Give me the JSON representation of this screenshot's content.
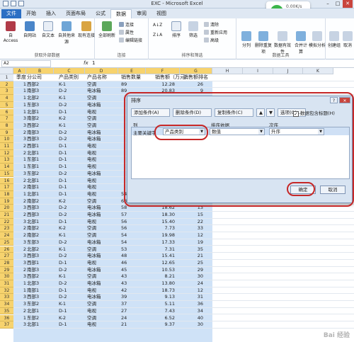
{
  "window": {
    "title": "EXC - Microsoft Excel"
  },
  "network": {
    "speed": "0.00K/s",
    "count": "1"
  },
  "tabs": [
    {
      "label": "文件"
    },
    {
      "label": "开始"
    },
    {
      "label": "插入"
    },
    {
      "label": "页面布局"
    },
    {
      "label": "公式"
    },
    {
      "label": "数据"
    },
    {
      "label": "审阅"
    },
    {
      "label": "视图"
    }
  ],
  "ribbon": {
    "get_external": {
      "label": "获取外部数据",
      "access": "自 Access",
      "web": "自网站",
      "text": "自文本",
      "other": "自其他来源",
      "existing": "现有连接"
    },
    "connections": {
      "label": "连接",
      "refresh": "全部刷新",
      "conn": "连接",
      "props": "属性",
      "edit": "编辑链接"
    },
    "sort_filter": {
      "label": "排序和筛选",
      "az": "A↓Z",
      "za": "Z↓A",
      "sort": "排序",
      "filter": "筛选",
      "clear": "清除",
      "reapply": "重新应用",
      "advanced": "高级"
    },
    "tools": {
      "label": "数据工具",
      "split": "分列",
      "dedupe": "删除重复项",
      "validation": "数据有效性",
      "consolidate": "合并计算",
      "whatif": "模拟分析"
    },
    "outline": {
      "group": "创建组",
      "ungroup": "取消"
    }
  },
  "formula_bar": {
    "name_box": "A2",
    "fx": "fx",
    "value": "1"
  },
  "columns": [
    "A",
    "B",
    "C",
    "D",
    "E",
    "F",
    "G",
    "H",
    "I",
    "J",
    "K"
  ],
  "header_row": [
    "季度",
    "分公司",
    "产品类别",
    "产品名称",
    "销售数量",
    "销售额（万元）",
    "销售额排名"
  ],
  "rows": [
    [
      "1",
      "西部2",
      "K-1",
      "空调",
      "89",
      "12.28",
      "26"
    ],
    [
      "1",
      "南部3",
      "D-2",
      "电冰箱",
      "89",
      "20.83",
      "9"
    ],
    [
      "1",
      "北部2",
      "K-1",
      "空调",
      "",
      "",
      ""
    ],
    [
      "1",
      "东部3",
      "D-2",
      "电冰箱",
      "",
      "",
      ""
    ],
    [
      "1",
      "北部1",
      "D-1",
      "电视",
      "",
      "",
      ""
    ],
    [
      "3",
      "南部2",
      "K-2",
      "空调",
      "",
      "",
      ""
    ],
    [
      "3",
      "西部2",
      "K-1",
      "空调",
      "",
      "",
      ""
    ],
    [
      "2",
      "南部3",
      "D-2",
      "电冰箱",
      "",
      "",
      ""
    ],
    [
      "3",
      "西部3",
      "D-2",
      "电冰箱",
      "",
      "",
      ""
    ],
    [
      "2",
      "西部1",
      "D-1",
      "电视",
      "",
      "",
      ""
    ],
    [
      "2",
      "北部1",
      "D-1",
      "电视",
      "",
      "",
      ""
    ],
    [
      "1",
      "东部1",
      "D-1",
      "电视",
      "",
      "",
      ""
    ],
    [
      "1",
      "东部1",
      "D-1",
      "电视",
      "",
      "",
      ""
    ],
    [
      "3",
      "东部2",
      "D-2",
      "电冰箱",
      "",
      "",
      ""
    ],
    [
      "2",
      "北部1",
      "D-1",
      "电视",
      "",
      "",
      ""
    ],
    [
      "2",
      "南部1",
      "D-1",
      "电视",
      "",
      "",
      ""
    ],
    [
      "1",
      "北部1",
      "D-1",
      "电视",
      "54",
      "28.54",
      "5"
    ],
    [
      "2",
      "南部2",
      "K-2",
      "空调",
      "63",
      "22.98",
      "8"
    ],
    [
      "3",
      "西部3",
      "D-2",
      "电冰箱",
      "58",
      "18.62",
      "13"
    ],
    [
      "2",
      "西部3",
      "D-2",
      "电冰箱",
      "57",
      "18.30",
      "15"
    ],
    [
      "3",
      "北部1",
      "D-1",
      "电视",
      "56",
      "15.40",
      "22"
    ],
    [
      "2",
      "南部2",
      "K-2",
      "空调",
      "56",
      "7.73",
      "33"
    ],
    [
      "2",
      "南部2",
      "K-1",
      "空调",
      "54",
      "19.98",
      "12"
    ],
    [
      "3",
      "东部3",
      "D-2",
      "电冰箱",
      "54",
      "17.33",
      "19"
    ],
    [
      "2",
      "北部2",
      "K-1",
      "空调",
      "53",
      "7.31",
      "35"
    ],
    [
      "3",
      "西部3",
      "D-2",
      "电冰箱",
      "48",
      "15.41",
      "21"
    ],
    [
      "3",
      "西部1",
      "D-1",
      "电视",
      "46",
      "12.65",
      "25"
    ],
    [
      "2",
      "南部3",
      "D-2",
      "电冰箱",
      "45",
      "10.53",
      "29"
    ],
    [
      "3",
      "西部2",
      "K-1",
      "空调",
      "43",
      "8.21",
      "30"
    ],
    [
      "1",
      "北部3",
      "D-2",
      "电冰箱",
      "43",
      "13.80",
      "24"
    ],
    [
      "1",
      "南部1",
      "D-1",
      "电视",
      "42",
      "18.73",
      "12"
    ],
    [
      "3",
      "西部3",
      "D-2",
      "电冰箱",
      "39",
      "9.13",
      "31"
    ],
    [
      "3",
      "东部2",
      "K-1",
      "空调",
      "37",
      "5.11",
      "36"
    ],
    [
      "2",
      "北部1",
      "D-1",
      "电视",
      "27",
      "7.43",
      "34"
    ],
    [
      "1",
      "东部2",
      "K-2",
      "空调",
      "24",
      "6.52",
      "40"
    ],
    [
      "3",
      "北部1",
      "D-1",
      "电视",
      "21",
      "9.37",
      "30"
    ]
  ],
  "dialog": {
    "title": "排序",
    "add_level": "添加条件(A)",
    "delete_level": "删除条件(D)",
    "copy_level": "复制条件(C)",
    "up": "▲",
    "down": "▼",
    "options": "选项(O)...",
    "has_header": "数据包含标题(H)",
    "col_header": "列",
    "sorton_header": "排序依据",
    "order_header": "次序",
    "primary_key": "主要关键字",
    "column_value": "产品类别",
    "sorton_value": "数值",
    "order_value": "升序",
    "ok": "确定",
    "cancel": "取消",
    "help": "?"
  },
  "watermark": "Bai 经验"
}
